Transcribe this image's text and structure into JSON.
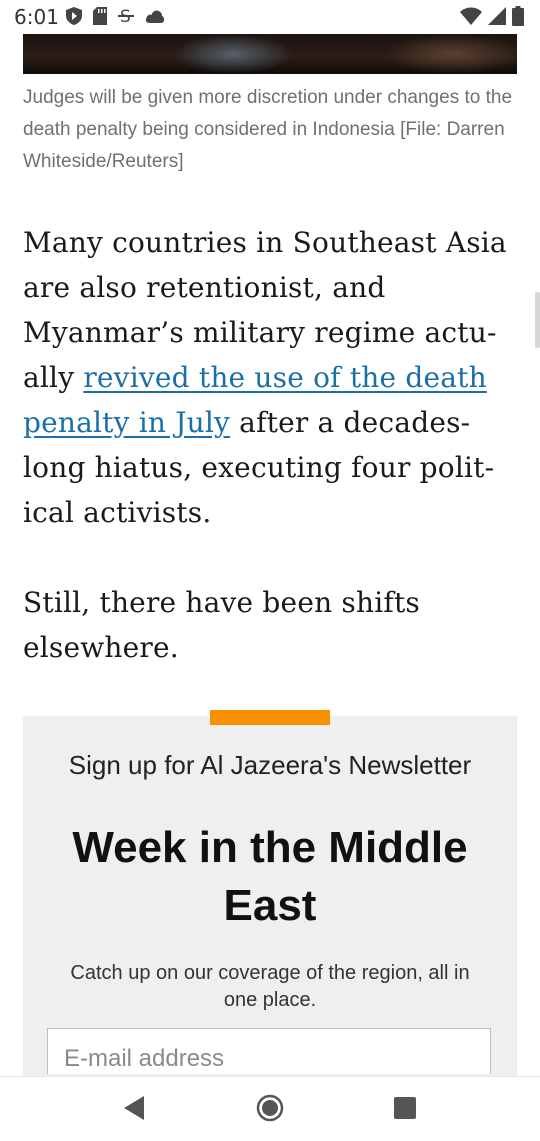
{
  "status_bar": {
    "time": "6:01",
    "icons_left": [
      "shield-play-icon",
      "sd-card-icon",
      "strikethrough-s-icon",
      "cloud-icon"
    ],
    "icons_right": [
      "wifi-icon",
      "signal-icon",
      "battery-icon"
    ]
  },
  "article": {
    "photo_alt": "",
    "caption": "Judges will be given more discretion under changes to the death penalty being considered in Indonesia  [File: Darren Whiteside/Reuters]",
    "para1_before": "Many countries in Southeast Asia are also retentionist, and Myanmar’s military regime actu­ally ",
    "para1_link": "revived the use of the death penalty in July",
    "para1_after": " after a decades-long hiatus, executing four polit­ical activists.",
    "para2": "Still, there have been shifts elsewhere."
  },
  "newsletter": {
    "signup": "Sign up for Al Jazeera's Newsletter",
    "title": "Week in the Middle East",
    "description": "Catch up on our coverage of the region, all in one place.",
    "email_placeholder": "E-mail address",
    "accent_color": "#fa9000"
  },
  "nav_bar": {
    "buttons": [
      "back-icon",
      "home-icon",
      "recents-icon"
    ]
  }
}
